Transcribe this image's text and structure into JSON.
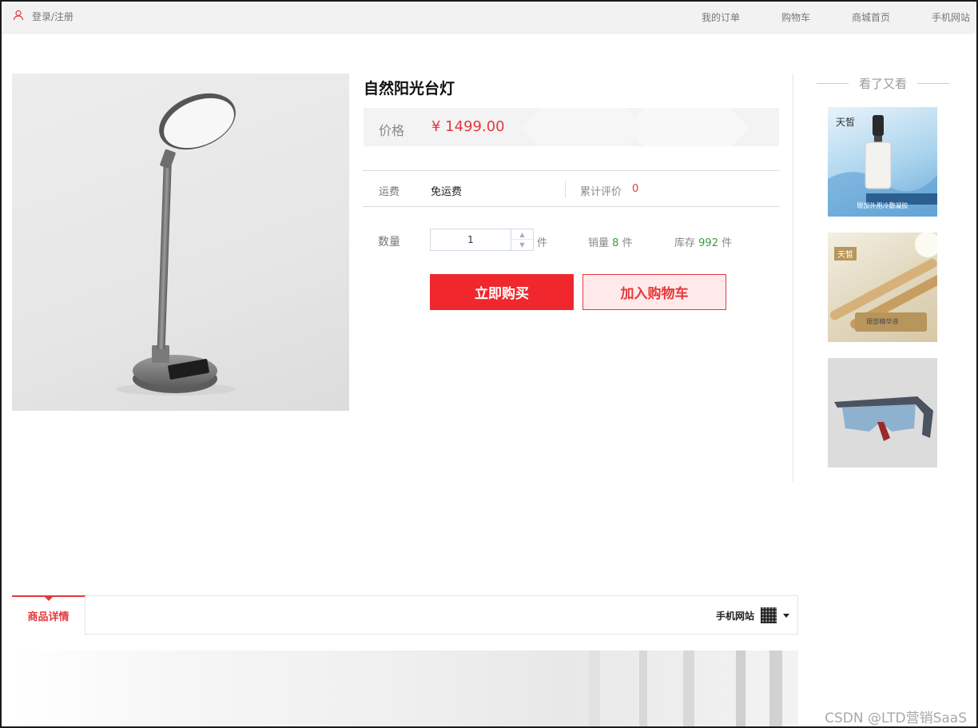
{
  "topbar": {
    "login_label": "登录/注册",
    "nav": [
      "我的订单",
      "购物车",
      "商城首页",
      "手机网站"
    ]
  },
  "product": {
    "title": "自然阳光台灯",
    "price_label": "价格",
    "price": "¥ 1499.00",
    "shipping_label": "运费",
    "shipping_value": "免运费",
    "reviews_label": "累计评价",
    "reviews_count": "0",
    "quantity_label": "数量",
    "quantity_value": "1",
    "quantity_unit": "件",
    "sales_label": "销量",
    "sales_count": "8",
    "sales_unit": "件",
    "stock_label": "库存",
    "stock_count": "992",
    "stock_unit": "件",
    "buy_now_label": "立即购买",
    "add_to_cart_label": "加入购物车"
  },
  "sidebar": {
    "title": "看了又看",
    "items": [
      {
        "brand": "天皙",
        "caption": "眼部外用冷敷凝胶"
      },
      {
        "brand": "天皙",
        "caption": "眼部精华液"
      },
      {
        "brand": "",
        "caption": ""
      }
    ]
  },
  "details": {
    "tab_label": "商品详情",
    "mobile_site_label": "手机网站"
  },
  "watermark": "CSDN @LTD营销SaaS",
  "colors": {
    "accent": "#e4393c",
    "buy_button": "#f0282d",
    "cart_button_bg": "#ffe9ea",
    "stat_green": "#3c9a3c",
    "topbar_bg": "#f2f2f2"
  }
}
